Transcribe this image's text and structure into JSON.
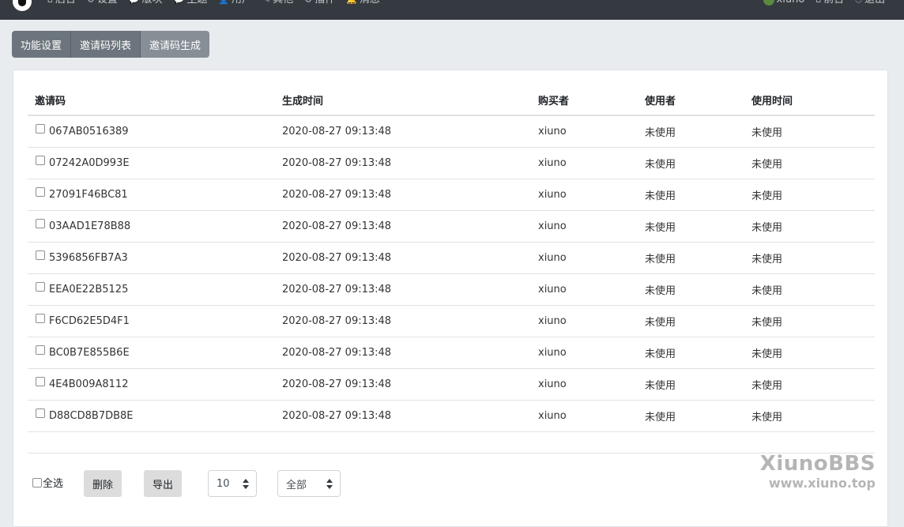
{
  "navbar": {
    "left_items": [
      {
        "icon": "home-icon",
        "glyph": "⌂",
        "label": "后台"
      },
      {
        "icon": "gear-icon",
        "glyph": "⚙",
        "label": "设置"
      },
      {
        "icon": "comment-icon",
        "glyph": "💬",
        "label": "版块"
      },
      {
        "icon": "comments-icon",
        "glyph": "💬",
        "label": "主题"
      },
      {
        "icon": "user-icon",
        "glyph": "👤",
        "label": "用户"
      },
      {
        "icon": "wrench-icon",
        "glyph": "✎",
        "label": "其他"
      },
      {
        "icon": "puzzle-icon",
        "glyph": "⚙",
        "label": "插件"
      },
      {
        "icon": "bell-icon",
        "glyph": "🔔",
        "label": "消息"
      }
    ],
    "right_items": [
      {
        "icon": "avatar-icon",
        "label": "xiuno"
      },
      {
        "icon": "home-icon",
        "glyph": "⌂",
        "label": "前台"
      },
      {
        "icon": "logout-icon",
        "glyph": "⎋",
        "label": "退出"
      }
    ]
  },
  "tabs": [
    {
      "label": "功能设置",
      "active": false
    },
    {
      "label": "邀请码列表",
      "active": false
    },
    {
      "label": "邀请码生成",
      "active": true
    }
  ],
  "table": {
    "headers": [
      "邀请码",
      "生成时间",
      "购买者",
      "使用者",
      "使用时间"
    ],
    "rows": [
      {
        "code": "067AB0516389",
        "created": "2020-08-27 09:13:48",
        "buyer": "xiuno",
        "user": "未使用",
        "used_time": "未使用"
      },
      {
        "code": "07242A0D993E",
        "created": "2020-08-27 09:13:48",
        "buyer": "xiuno",
        "user": "未使用",
        "used_time": "未使用"
      },
      {
        "code": "27091F46BC81",
        "created": "2020-08-27 09:13:48",
        "buyer": "xiuno",
        "user": "未使用",
        "used_time": "未使用"
      },
      {
        "code": "03AAD1E78B88",
        "created": "2020-08-27 09:13:48",
        "buyer": "xiuno",
        "user": "未使用",
        "used_time": "未使用"
      },
      {
        "code": "5396856FB7A3",
        "created": "2020-08-27 09:13:48",
        "buyer": "xiuno",
        "user": "未使用",
        "used_time": "未使用"
      },
      {
        "code": "EEA0E22B5125",
        "created": "2020-08-27 09:13:48",
        "buyer": "xiuno",
        "user": "未使用",
        "used_time": "未使用"
      },
      {
        "code": "F6CD62E5D4F1",
        "created": "2020-08-27 09:13:48",
        "buyer": "xiuno",
        "user": "未使用",
        "used_time": "未使用"
      },
      {
        "code": "BC0B7E855B6E",
        "created": "2020-08-27 09:13:48",
        "buyer": "xiuno",
        "user": "未使用",
        "used_time": "未使用"
      },
      {
        "code": "4E4B009A8112",
        "created": "2020-08-27 09:13:48",
        "buyer": "xiuno",
        "user": "未使用",
        "used_time": "未使用"
      },
      {
        "code": "D88CD8B7DB8E",
        "created": "2020-08-27 09:13:48",
        "buyer": "xiuno",
        "user": "未使用",
        "used_time": "未使用"
      }
    ]
  },
  "footer": {
    "select_all_label": "全选",
    "delete_label": "删除",
    "export_label": "导出",
    "per_page_value": "10",
    "filter_value": "全部"
  },
  "watermark": {
    "title": "XiunoBBS",
    "url": "www.xiuno.top"
  }
}
